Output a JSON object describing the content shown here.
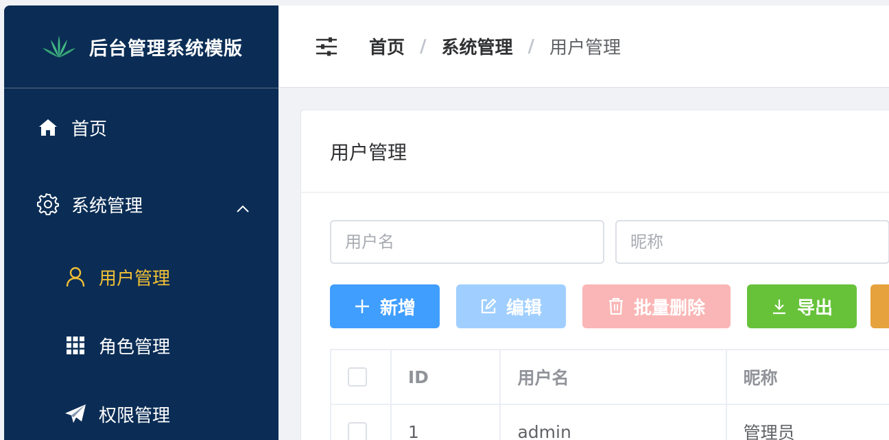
{
  "sidebar": {
    "brand_title": "后台管理系统模版",
    "items": [
      {
        "label": "首页",
        "icon": "home-icon"
      },
      {
        "label": "系统管理",
        "icon": "gear-icon",
        "expanded": true
      },
      {
        "label": "用户管理",
        "icon": "user-icon",
        "active": true
      },
      {
        "label": "角色管理",
        "icon": "grid-icon"
      },
      {
        "label": "权限管理",
        "icon": "paper-plane-icon"
      }
    ]
  },
  "header": {
    "breadcrumb": [
      "首页",
      "系统管理",
      "用户管理"
    ],
    "separator": "/"
  },
  "card": {
    "title": "用户管理",
    "search": {
      "username_placeholder": "用户名",
      "nickname_placeholder": "昵称"
    },
    "buttons": {
      "add": "新增",
      "edit": "编辑",
      "batch_delete": "批量删除",
      "export": "导出"
    },
    "table": {
      "columns": [
        "ID",
        "用户名",
        "昵称"
      ],
      "rows": [
        {
          "id": "1",
          "username": "admin",
          "nickname": "管理员"
        }
      ]
    }
  },
  "colors": {
    "sidebar_bg": "#0b2d55",
    "active": "#f2c034",
    "primary": "#409eff",
    "success": "#67c23a",
    "danger_light": "#fab6b6",
    "warning": "#e6a23c"
  }
}
